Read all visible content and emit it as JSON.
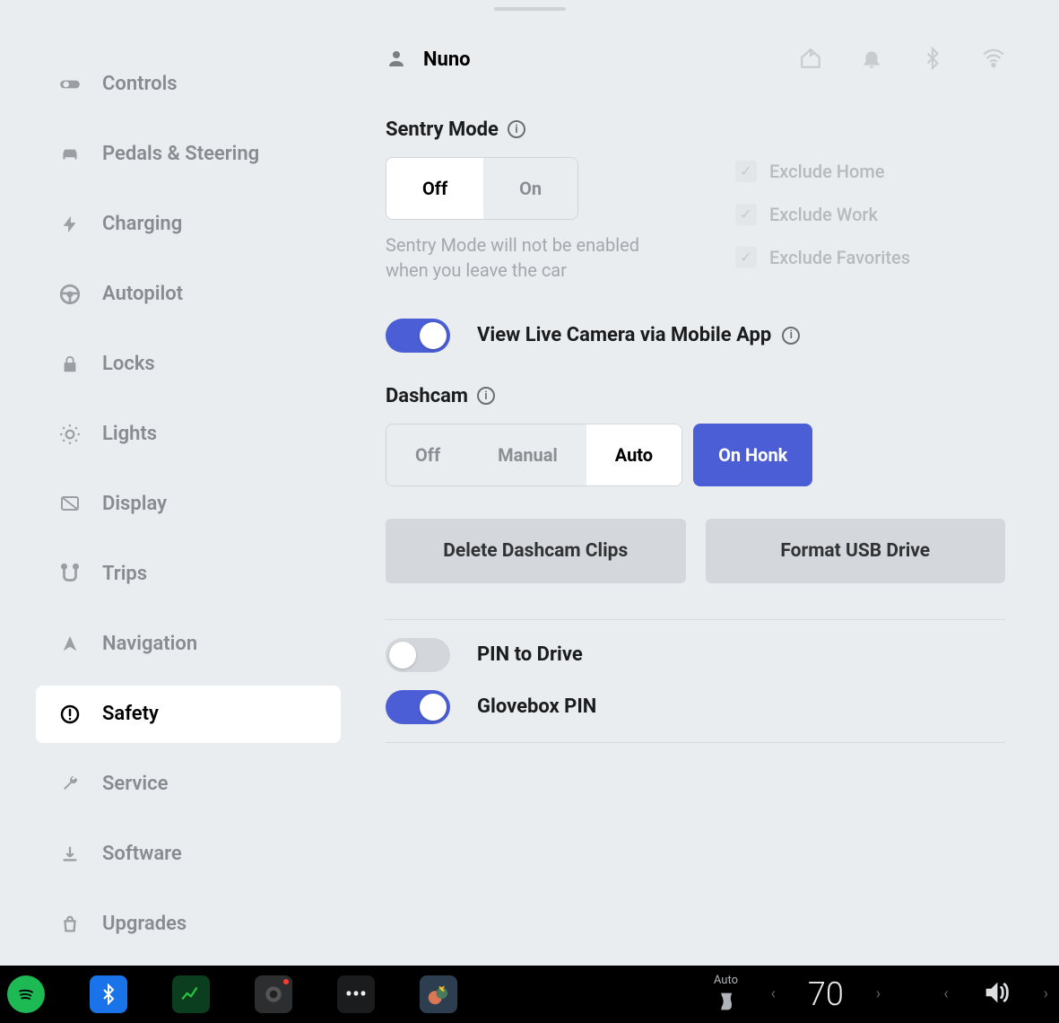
{
  "user": {
    "name": "Nuno"
  },
  "sidebar": {
    "items": [
      {
        "label": "Controls"
      },
      {
        "label": "Pedals & Steering"
      },
      {
        "label": "Charging"
      },
      {
        "label": "Autopilot"
      },
      {
        "label": "Locks"
      },
      {
        "label": "Lights"
      },
      {
        "label": "Display"
      },
      {
        "label": "Trips"
      },
      {
        "label": "Navigation"
      },
      {
        "label": "Safety"
      },
      {
        "label": "Service"
      },
      {
        "label": "Software"
      },
      {
        "label": "Upgrades"
      }
    ]
  },
  "sentry": {
    "title": "Sentry Mode",
    "off": "Off",
    "on": "On",
    "helper": "Sentry Mode will not be enabled when you leave the car",
    "exclude_home": "Exclude Home",
    "exclude_work": "Exclude Work",
    "exclude_favorites": "Exclude Favorites"
  },
  "live_camera": {
    "label": "View Live Camera via Mobile App"
  },
  "dashcam": {
    "title": "Dashcam",
    "off": "Off",
    "manual": "Manual",
    "auto": "Auto",
    "on_honk": "On Honk",
    "delete": "Delete Dashcam Clips",
    "format": "Format USB Drive"
  },
  "pin_drive": {
    "label": "PIN to Drive"
  },
  "glovebox_pin": {
    "label": "Glovebox PIN"
  },
  "bottombar": {
    "seat_mode": "Auto",
    "temperature": "70"
  }
}
